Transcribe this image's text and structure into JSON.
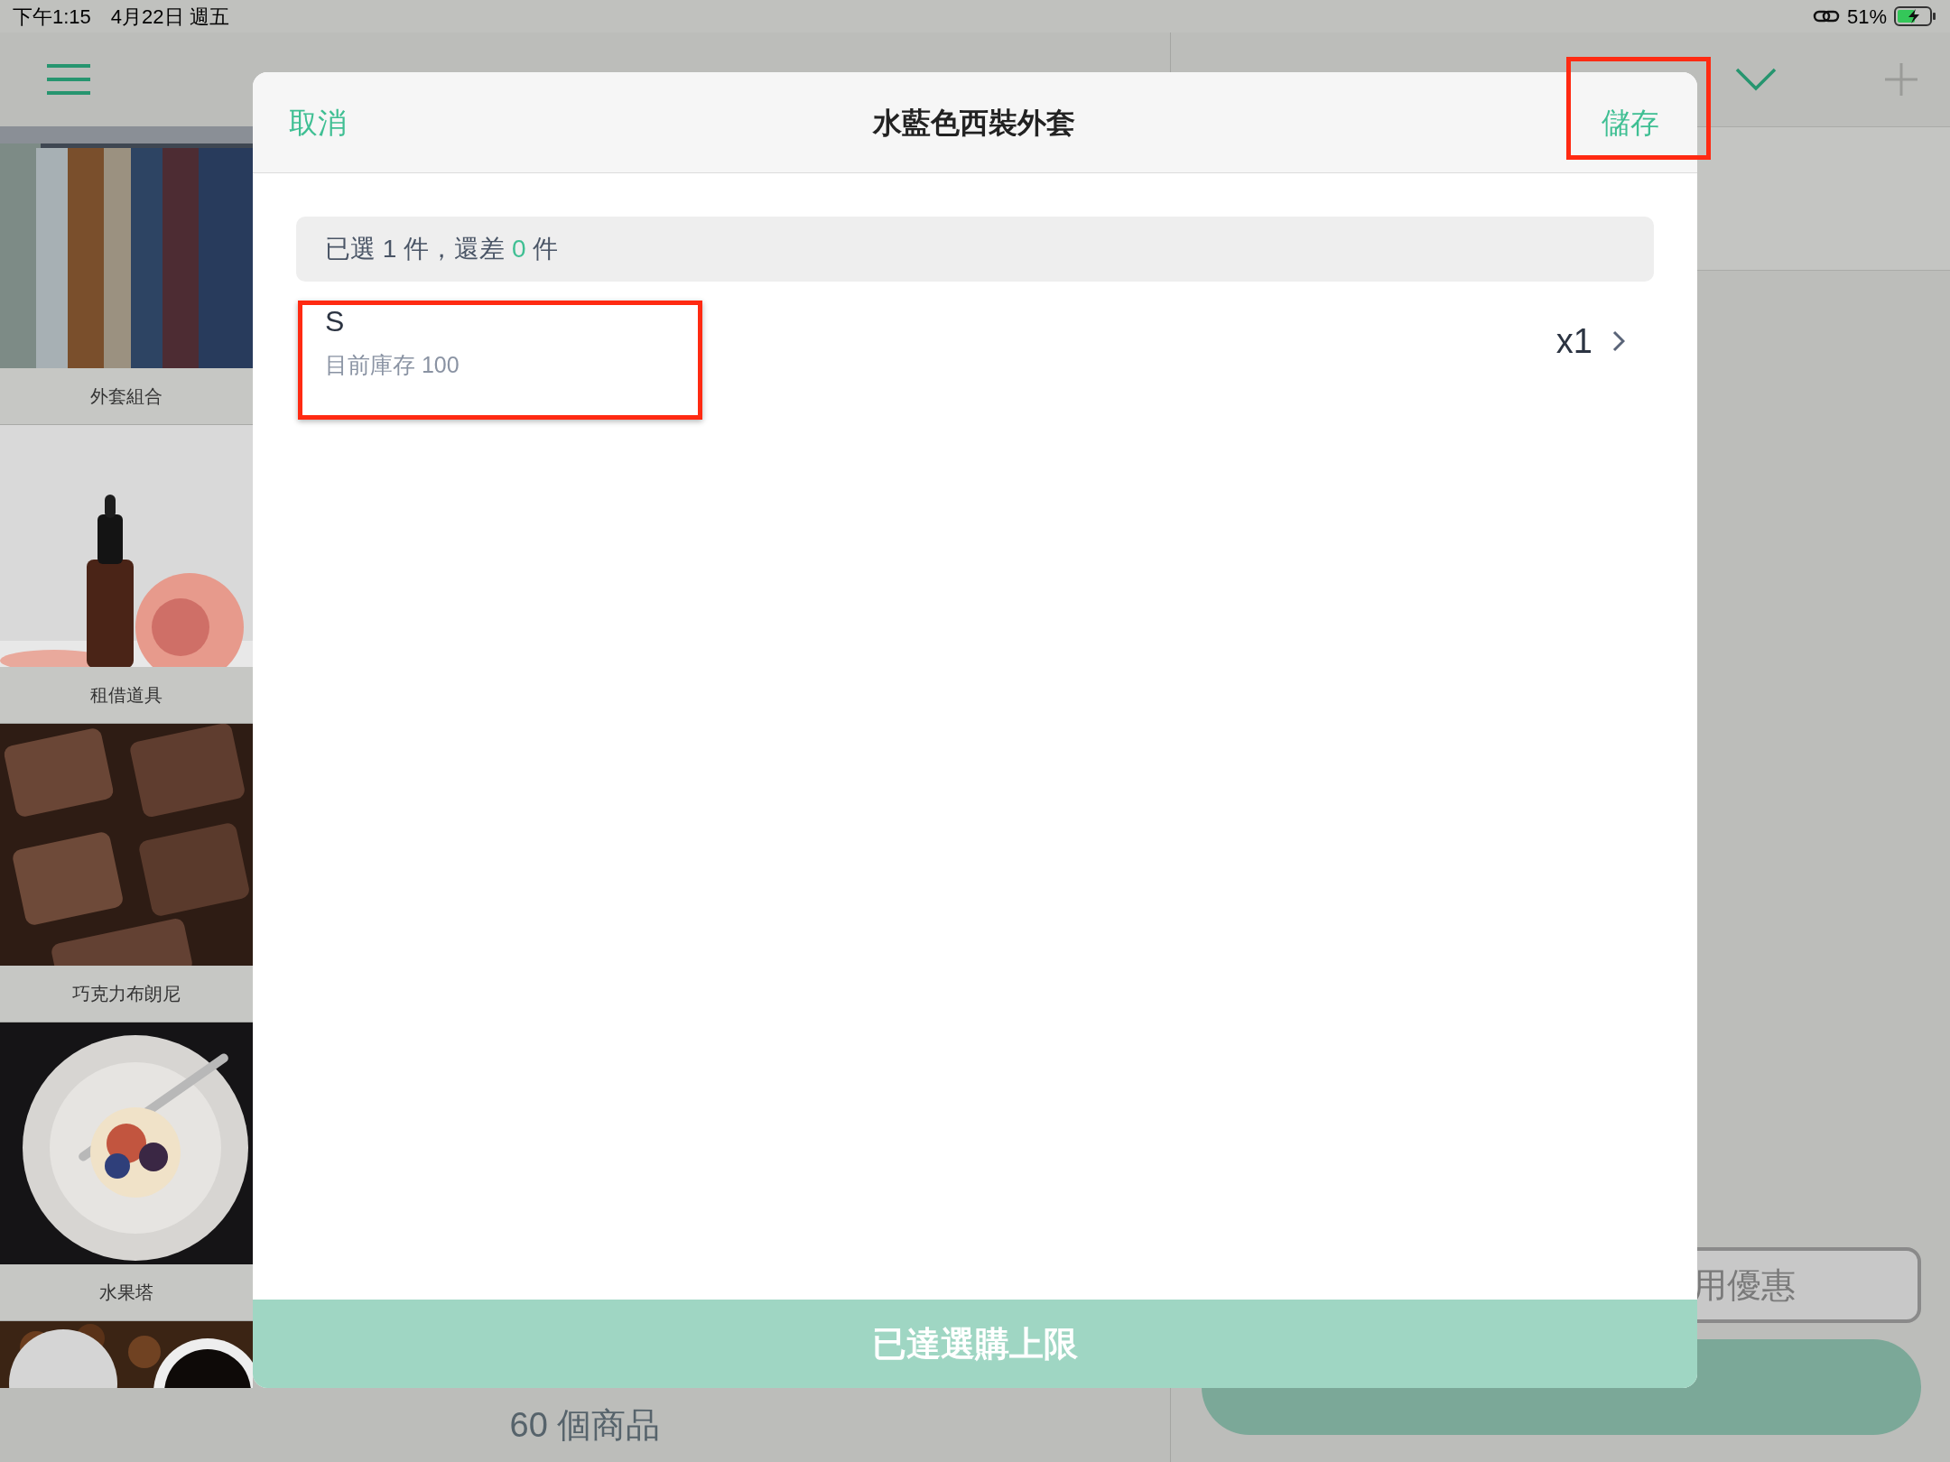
{
  "status_bar": {
    "time": "下午1:15",
    "date": "4月22日 週五",
    "battery": "51%"
  },
  "categories": [
    {
      "label": "外套組合",
      "kind": "picture"
    },
    {
      "label": "租借道具",
      "kind": "picture"
    },
    {
      "label": "巧克力布朗尼",
      "kind": "picture"
    },
    {
      "label": "水果塔",
      "kind": "picture"
    },
    {
      "kind": "picture"
    }
  ],
  "product_count": "60 個商品",
  "cart": {
    "coupon_button": "用優惠"
  },
  "dialog": {
    "title": "水藍色西裝外套",
    "cancel": "取消",
    "save": {
      "label": "儲存",
      "highlighted": true
    },
    "summary": {
      "before": "已選 1 件，還差",
      "count": "0",
      "after": "件"
    },
    "options": [
      {
        "name": "S",
        "stock": "目前庫存 100",
        "quantity": "x1",
        "highlighted": true
      }
    ],
    "limit_button": {
      "label": "已達選購上限",
      "disabled": true
    }
  }
}
